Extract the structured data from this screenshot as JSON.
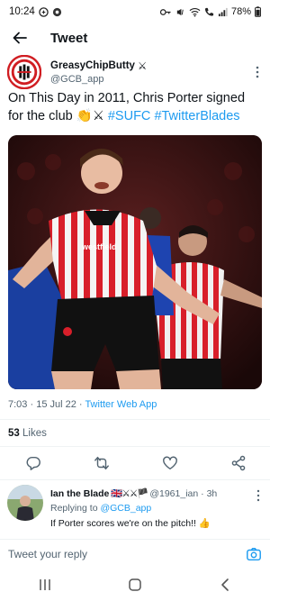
{
  "status_bar": {
    "time": "10:24",
    "battery": "78%"
  },
  "header": {
    "title": "Tweet"
  },
  "tweet": {
    "author_name": "GreasyChipButty",
    "author_emoji": "⚔",
    "author_handle": "@GCB_app",
    "text_before": "On This Day in 2011, Chris Porter signed for the club ",
    "text_emoji": "👏⚔",
    "hashtags": [
      "#SUFC",
      "#TwitterBlades"
    ],
    "photo_sponsor": "westfield",
    "time": "7:03",
    "date": "15 Jul 22",
    "source": "Twitter Web App",
    "likes_count": "53",
    "likes_label": "Likes"
  },
  "reply": {
    "name": "Ian the Blade",
    "flags": "🇬🇧⚔⚔🏴",
    "handle": "@1961_ian",
    "age": "3h",
    "replying_to_label": "Replying to",
    "replying_to_handle": "@GCB_app",
    "text": "If Porter scores we're on the pitch!! 👍"
  },
  "compose": {
    "placeholder": "Tweet your reply"
  },
  "colors": {
    "accent": "#1d9bf0",
    "secondary_text": "#536471",
    "divider": "#eff3f4"
  },
  "icons": [
    "back-arrow-icon",
    "more-icon",
    "reply-icon",
    "retweet-icon",
    "like-icon",
    "share-icon",
    "camera-icon",
    "recent-apps-icon",
    "home-icon",
    "back-icon"
  ]
}
